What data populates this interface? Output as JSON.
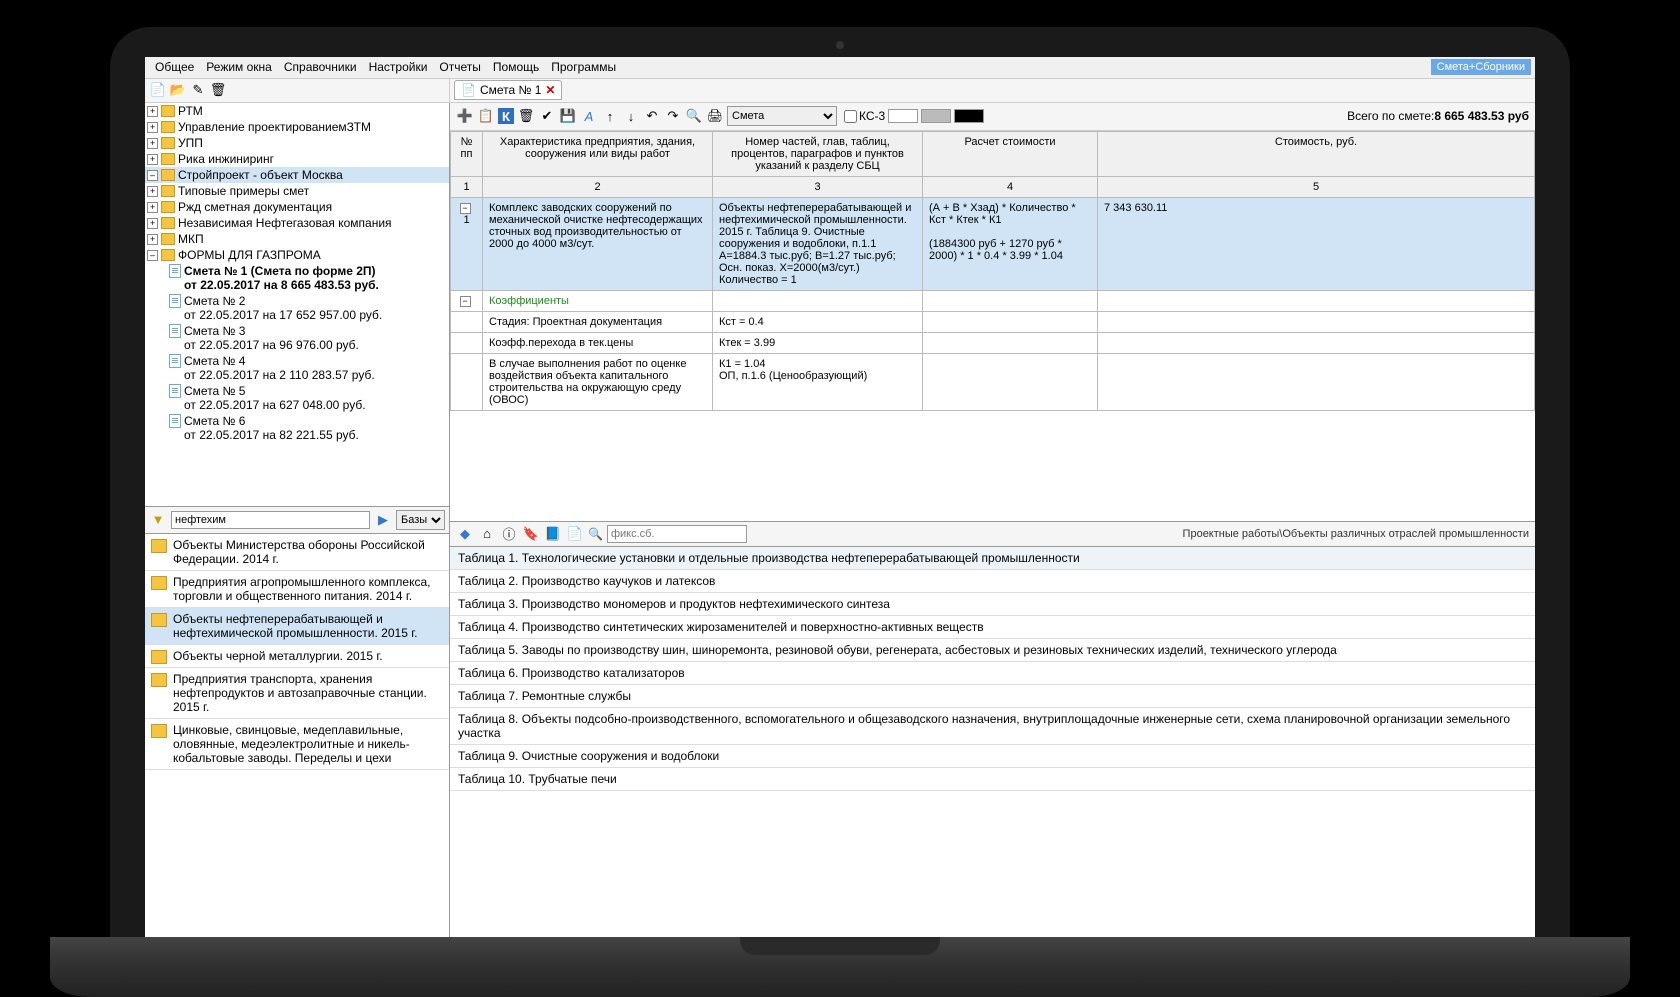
{
  "menubar": {
    "items": [
      "Общее",
      "Режим окна",
      "Справочники",
      "Настройки",
      "Отчеты",
      "Помощь",
      "Программы"
    ],
    "right_label": "Смета+Сборники"
  },
  "tab": {
    "title": "Смета № 1"
  },
  "toolbar": {
    "dropdown_value": "Смета",
    "ks3_label": "КС-3",
    "total_label": "Всего по смете:",
    "total_value": "8 665 483.53 руб"
  },
  "tree": {
    "nodes": [
      {
        "label": "РТМ",
        "expander": "+"
      },
      {
        "label": "Управление проектированиемЗТМ",
        "expander": "+"
      },
      {
        "label": "УПП",
        "expander": "+"
      },
      {
        "label": "Рика инжиниринг",
        "expander": "+"
      },
      {
        "label": "Стройпроект - объект Москва",
        "expander": "–",
        "selected": true
      },
      {
        "label": "Типовые примеры смет",
        "expander": "+"
      },
      {
        "label": "Ржд сметная документация",
        "expander": "+"
      },
      {
        "label": "Независимая Нефтегазовая компания",
        "expander": "+"
      },
      {
        "label": "МКП",
        "expander": "+"
      },
      {
        "label": "ФОРМЫ ДЛЯ ГАЗПРОМА",
        "expander": "–",
        "open": true
      }
    ],
    "docs": [
      {
        "title": "Смета № 1 (Смета по форме 2П)",
        "sub": "от 22.05.2017 на 8 665 483.53 руб.",
        "active": true
      },
      {
        "title": "Смета № 2",
        "sub": "от 22.05.2017 на 17 652 957.00 руб."
      },
      {
        "title": "Смета № 3",
        "sub": "от 22.05.2017 на 96 976.00 руб."
      },
      {
        "title": "Смета № 4",
        "sub": "от 22.05.2017 на 2 110 283.57 руб."
      },
      {
        "title": "Смета № 5",
        "sub": "от 22.05.2017 на 627 048.00 руб."
      },
      {
        "title": "Смета № 6",
        "sub": "от 22.05.2017 на 82 221.55 руб."
      }
    ]
  },
  "filter": {
    "search_value": "нефтехим",
    "select_value": "Базы"
  },
  "reflist": [
    {
      "text": "Объекты Министерства обороны Российской Федерации. 2014 г."
    },
    {
      "text": "Предприятия агропромышленного комплекса, торговли и общественного питания. 2014 г."
    },
    {
      "text": "Объекты нефтеперерабатывающей и нефтехимической промышленности. 2015 г.",
      "selected": true
    },
    {
      "text": "Объекты черной металлургии. 2015 г."
    },
    {
      "text": "Предприятия транспорта, хранения нефтепродуктов и автозаправочные станции. 2015 г."
    },
    {
      "text": "Цинковые, свинцовые, медеплавильные, оловянные, медеэлектролитные и никель-кобальтовые заводы. Переделы и цехи"
    }
  ],
  "grid": {
    "headers": {
      "num": "№ пп",
      "c2": "Характеристика предприятия, здания, сооружения или виды работ",
      "c3": "Номер частей, глав, таблиц, процентов, параграфов и пунктов указаний к разделу СБЦ",
      "c4": "Расчет стоимости",
      "c5": "Стоимость, руб."
    },
    "colnums": [
      "1",
      "2",
      "3",
      "4",
      "5"
    ],
    "row1": {
      "num": "1",
      "c2": "Комплекс заводских сооружений по механической очистке нефтесодержащих сточных вод производительностью от 2000 до 4000 м3/сут.",
      "c3": "Объекты нефтеперерабатывающей и нефтехимической промышленности. 2015 г. Таблица 9. Очистные сооружения и водоблоки, п.1.1 А=1884.3 тыс.руб; В=1.27 тыс.руб; Осн. показ. Х=2000(м3/сут.) Количество = 1",
      "c4": "(А + В * Хзад) * Количество * Кст * Ктек * К1\n\n(1884300 руб + 1270 руб * 2000) * 1 * 0.4 * 3.99 * 1.04",
      "c5": "7 343 630.11"
    },
    "coef_label": "Коэффициенты",
    "rows": [
      {
        "c2": "Стадия: Проектная документация",
        "c3": "Кст = 0.4"
      },
      {
        "c2": "Коэфф.перехода в тек.цены",
        "c3": "Ктек = 3.99"
      },
      {
        "c2": "В случае выполнения работ по оценке воздействия объекта капитального строительства на окружающую среду (ОВОС)",
        "c3": "К1 = 1.04\nОП, п.1.6 (Ценообразующий)"
      }
    ]
  },
  "nav": {
    "placeholder": "фикс.сб.",
    "breadcrumb": "Проектные работы\\Объекты различных отраслей промышленности"
  },
  "tables": [
    "Таблица 1. Технологические установки и отдельные производства нефтеперерабатывающей промышленности",
    "Таблица 2. Производство каучуков и латексов",
    "Таблица 3. Производство мономеров и продуктов нефтехимического синтеза",
    "Таблица 4. Производство синтетических жирозаменителей и поверхностно-активных веществ",
    "Таблица 5. Заводы по производству шин, шиноремонта, резиновой обуви, регенерата, асбестовых и резиновых технических изделий, технического углерода",
    "Таблица 6. Производство катализаторов",
    "Таблица 7. Ремонтные службы",
    "Таблица 8. Объекты подсобно-производственного, вспомогательного и общезаводского назначения, внутриплощадочные инженерные сети, схема планировочной организации земельного участка",
    "Таблица 9. Очистные сооружения и водоблоки",
    "Таблица 10. Трубчатые печи"
  ]
}
